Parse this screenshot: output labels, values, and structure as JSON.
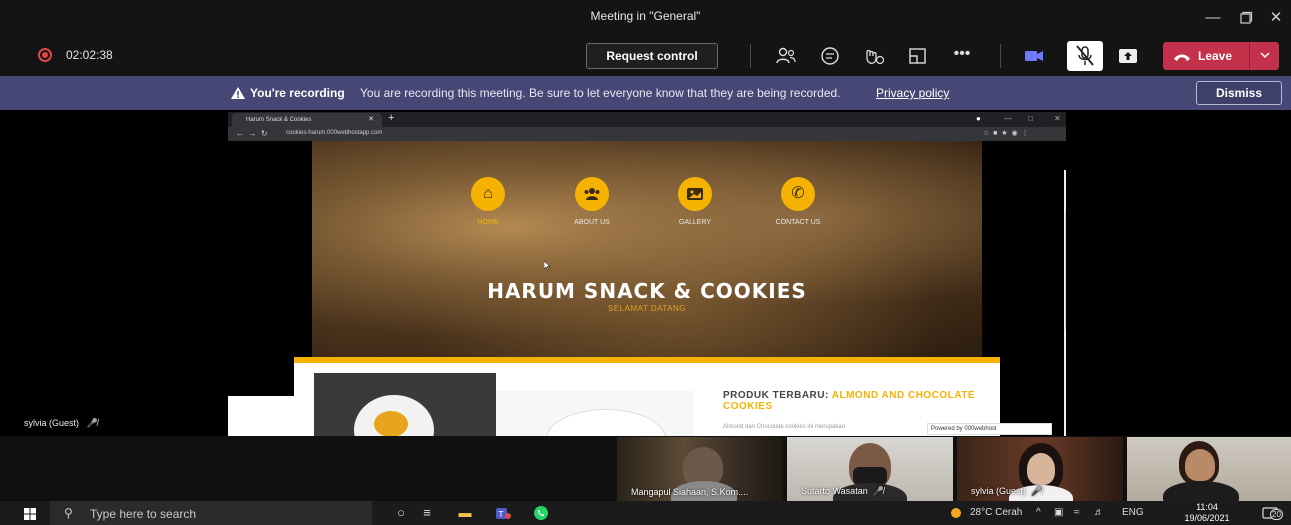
{
  "window": {
    "title": "Meeting in \"General\""
  },
  "toolbar": {
    "timer": "02:02:38",
    "request_control_label": "Request control",
    "leave_label": "Leave",
    "icons": [
      "people-icon",
      "chat-icon",
      "reactions-icon",
      "rooms-icon",
      "more-icon",
      "camera-icon",
      "mic-off-icon",
      "share-icon"
    ]
  },
  "banner": {
    "strong": "You're recording",
    "message": "You are recording this meeting. Be sure to let everyone know that they are being recorded.",
    "privacy_link": "Privacy policy",
    "dismiss_label": "Dismiss"
  },
  "browser": {
    "tab_title": "Harum Snack & Cookies",
    "url": "cookies-harum.000webhostapp.com",
    "nav": [
      {
        "label": "HOME",
        "icon": "home-icon",
        "active": true
      },
      {
        "label": "ABOUT US",
        "icon": "users-icon",
        "active": false
      },
      {
        "label": "GALLERY",
        "icon": "image-icon",
        "active": false
      },
      {
        "label": "CONTACT US",
        "icon": "phone-icon",
        "active": false
      }
    ],
    "hero_title": "HARUM SNACK & COOKIES",
    "hero_subtitle": "SELAMAT DATANG",
    "product_label": "PRODUK TERBARU: ",
    "product_name": "ALMOND AND CHOCOLATE COOKIES",
    "product_desc": "Almond dan Chocolate cookies ini merupakan",
    "powered_by": "Powered by  000webhost"
  },
  "participants": {
    "spotlight_name": "sylvia (Guest)",
    "tiles": [
      {
        "name": "Mangapul Siahaan, S.Kom...."
      },
      {
        "name": "Sutarto Wasatan"
      },
      {
        "name": "sylvia (Guest)"
      },
      {
        "name": ""
      }
    ]
  },
  "taskbar": {
    "search_placeholder": "Type here to search",
    "weather": "28°C  Cerah",
    "language": "ENG",
    "time": "11:04",
    "date": "19/06/2021",
    "notifications": "20"
  },
  "colors": {
    "banner": "#464775",
    "leave": "#c4314b",
    "accent_yellow": "#f6b203"
  }
}
